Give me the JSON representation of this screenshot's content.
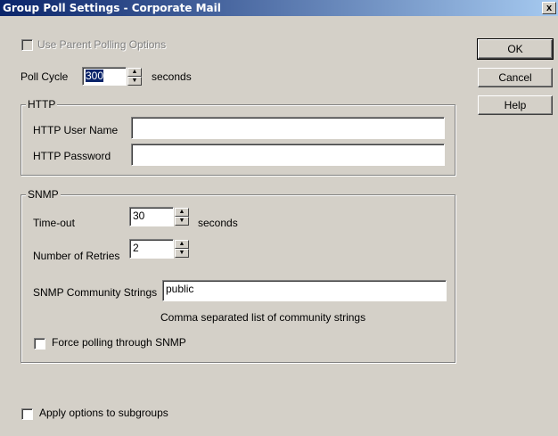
{
  "window": {
    "title": "Group Poll Settings - Corporate Mail",
    "close_glyph": "x"
  },
  "use_parent": {
    "label": "Use Parent Polling Options",
    "checked": false,
    "enabled": false
  },
  "poll_cycle": {
    "label": "Poll Cycle",
    "value": "300",
    "unit": "seconds"
  },
  "http": {
    "group_label": "HTTP",
    "user_label": "HTTP User Name",
    "user_value": "",
    "password_label": "HTTP Password",
    "password_value": ""
  },
  "snmp": {
    "group_label": "SNMP",
    "timeout_label": "Time-out",
    "timeout_value": "30",
    "timeout_unit": "seconds",
    "retries_label": "Number of Retries",
    "retries_value": "2",
    "community_label": "SNMP Community Strings",
    "community_value": "public",
    "community_hint": "Comma separated list of community strings",
    "force_label": "Force polling through SNMP",
    "force_checked": false
  },
  "apply_subgroups": {
    "label": "Apply options to subgroups",
    "checked": false
  },
  "buttons": {
    "ok": "OK",
    "cancel": "Cancel",
    "help": "Help"
  }
}
